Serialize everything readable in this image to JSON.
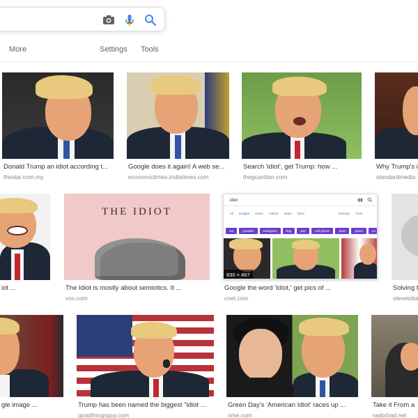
{
  "search": {
    "camera_icon": "camera-icon",
    "mic_icon": "microphone-icon",
    "search_icon": "search-icon"
  },
  "nav": {
    "more": "More",
    "settings": "Settings",
    "tools": "Tools"
  },
  "results": [
    {
      "caption": "Donald Trump an idiot according t...",
      "source": "thestar.com.my"
    },
    {
      "caption": "Google does it again! A web se...",
      "source": "economictimes.indiatimes.com"
    },
    {
      "caption": "Search 'idiot', get Trump: how ...",
      "source": "theguardian.com"
    },
    {
      "caption": "Why Trump's i",
      "source": "standardmedia."
    },
    {
      "caption": "iot ...",
      "source": ""
    },
    {
      "caption": "The Idiot is mostly about semiotics. It ...",
      "source": "vox.com",
      "book_title": "THE IDIOT"
    },
    {
      "caption": "Google the word 'Idiot,' get pics of ...",
      "source": "cnet.com",
      "dimensions": "830 × 467",
      "mini": {
        "query": "idiot",
        "tabs": [
          "All",
          "Images",
          "News",
          "Videos",
          "Maps",
          "More",
          "Settings",
          "Tools"
        ],
        "chips": [
          "cat",
          "youtube",
          "instagram",
          "bag",
          "pari",
          "cell phone",
          "class",
          "poem",
          "co"
        ]
      }
    },
    {
      "caption": "Solving t",
      "source": "stevetoba"
    },
    {
      "caption": "gle image ...",
      "source": ""
    },
    {
      "caption": "Trump has been named the biggest \"idiot ...",
      "source": "goodthingsguy.com"
    },
    {
      "caption": "Green Day's 'American Idiot' races up ...",
      "source": "nme.com"
    },
    {
      "caption": "Take it From a",
      "source": "radorbad.net"
    }
  ],
  "colors": {
    "accent": "#1a73e8",
    "caption": "#333333",
    "source": "#888888",
    "chip": "#6a3fc9"
  }
}
